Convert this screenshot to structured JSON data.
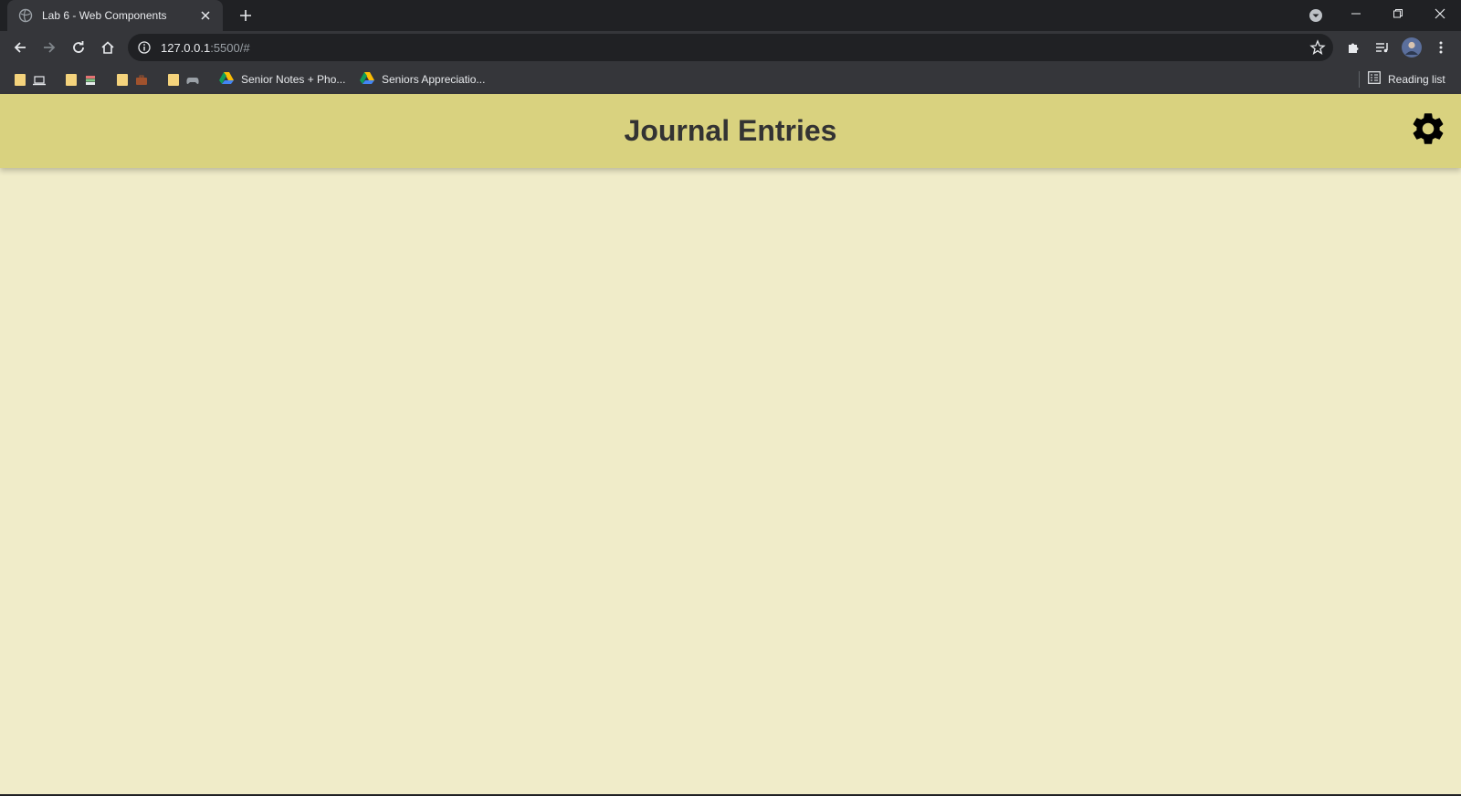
{
  "browser": {
    "tab": {
      "title": "Lab 6 - Web Components"
    },
    "address": {
      "host": "127.0.0.1",
      "path": ":5500/#"
    },
    "bookmarks": [
      {
        "label": "Senior Notes + Pho..."
      },
      {
        "label": "Seniors Appreciatio..."
      }
    ],
    "reading_list_label": "Reading list"
  },
  "app": {
    "title": "Journal Entries",
    "header_color": "#d9d27f",
    "background_color": "#f0ecc9",
    "settings_icon": "gear-icon"
  }
}
